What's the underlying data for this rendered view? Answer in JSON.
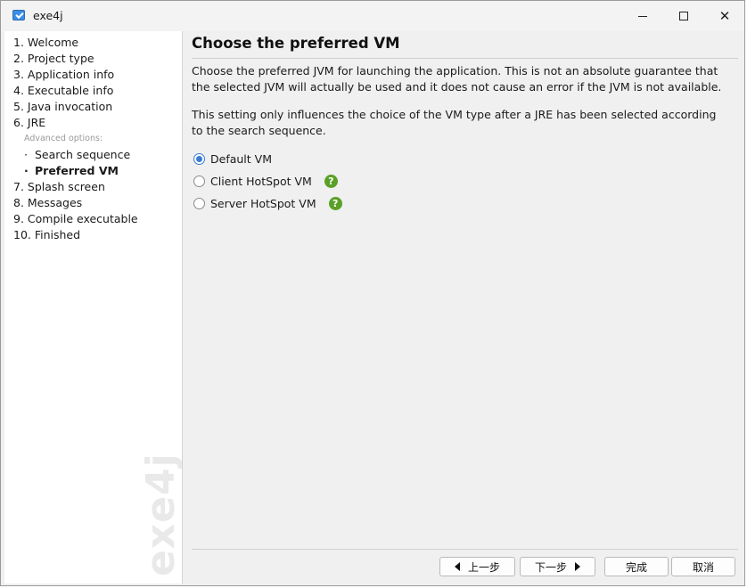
{
  "window": {
    "title": "exe4j",
    "minimize": "─",
    "maximize": "□",
    "close": "✕"
  },
  "sidebar": {
    "steps": [
      "1. Welcome",
      "2. Project type",
      "3. Application info",
      "4. Executable info",
      "5. Java invocation",
      "6. JRE"
    ],
    "advanced_label": "Advanced options:",
    "sub_steps": [
      "Search sequence",
      "Preferred VM"
    ],
    "steps_after": [
      "7. Splash screen",
      "8. Messages",
      "9. Compile executable",
      "10. Finished"
    ],
    "watermark": "exe4j"
  },
  "main": {
    "heading": "Choose the preferred VM",
    "paragraph1": "Choose the preferred JVM for launching the application. This is not an absolute guarantee that the selected JVM will actually be used and it does not cause an error if the JVM is not available.",
    "paragraph2": "This setting only influences the choice of the VM type after a JRE has been selected according to the search sequence.",
    "options": [
      {
        "label": "Default VM",
        "checked": true
      },
      {
        "label": "Client HotSpot VM",
        "help": "?"
      },
      {
        "label": "Server HotSpot VM",
        "help": "?"
      }
    ]
  },
  "buttons": {
    "back": "上一步",
    "next": "下一步",
    "finish": "完成",
    "cancel": "取消"
  },
  "colors": {
    "accent": "#3a7bd5",
    "help_icon": "#5aa028"
  }
}
